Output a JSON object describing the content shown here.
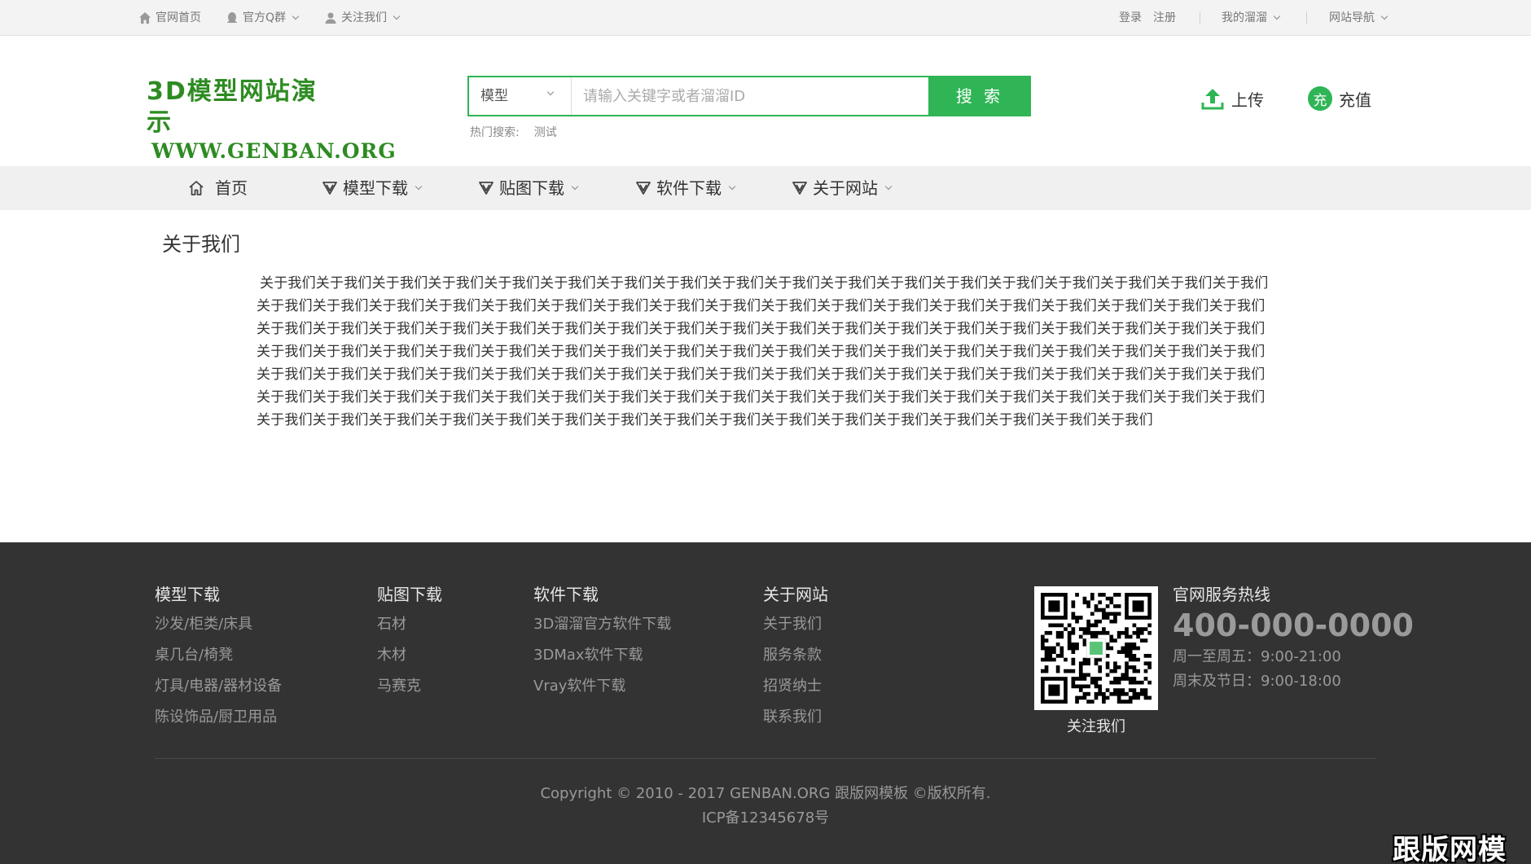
{
  "topbar": {
    "home": "官网首页",
    "qq_group": "官方Q群",
    "follow": "关注我们",
    "login": "登录",
    "register": "注册",
    "my_liuliu": "我的溜溜",
    "site_nav": "网站导航"
  },
  "header": {
    "logo_line1": "3D模型网站演示",
    "logo_line2": "WWW.GENBAN.ORG",
    "search_category": "模型",
    "search_placeholder": "请输入关键字或者溜溜ID",
    "search_button": "搜 索",
    "hot_label": "热门搜索:",
    "hot_term": "测试",
    "upload": "上传",
    "recharge": "充值",
    "recharge_badge": "充"
  },
  "nav": {
    "home": "首页",
    "models": "模型下载",
    "textures": "贴图下载",
    "software": "软件下载",
    "about": "关于网站"
  },
  "content": {
    "title": "关于我们",
    "body": "关于我们关于我们关于我们关于我们关于我们关于我们关于我们关于我们关于我们关于我们关于我们关于我们关于我们关于我们关于我们关于我们关于我们关于我们关于我们关于我们关于我们关于我们关于我们关于我们关于我们关于我们关于我们关于我们关于我们关于我们关于我们关于我们关于我们关于我们关于我们关于我们关于我们关于我们关于我们关于我们关于我们关于我们关于我们关于我们关于我们关于我们关于我们关于我们关于我们关于我们关于我们关于我们关于我们关于我们关于我们关于我们关于我们关于我们关于我们关于我们关于我们关于我们关于我们关于我们关于我们关于我们关于我们关于我们关于我们关于我们关于我们关于我们关于我们关于我们关于我们关于我们关于我们关于我们关于我们关于我们关于我们关于我们关于我们关于我们关于我们关于我们关于我们关于我们关于我们关于我们关于我们关于我们关于我们关于我们关于我们关于我们关于我们关于我们关于我们关于我们关于我们关于我们关于我们关于我们关于我们关于我们关于我们关于我们关于我们关于我们关于我们关于我们关于我们关于我们关于我们关于我们关于我们关于我们关于我们关于我们关于我们关于我们关于我们关于我们"
  },
  "footer": {
    "col1": {
      "title": "模型下载",
      "links": [
        "沙发/柜类/床具",
        "桌几台/椅凳",
        "灯具/电器/器材设备",
        "陈设饰品/厨卫用品"
      ]
    },
    "col2": {
      "title": "贴图下载",
      "links": [
        "石材",
        "木材",
        "马赛克"
      ]
    },
    "col3": {
      "title": "软件下载",
      "links": [
        "3D溜溜官方软件下载",
        "3DMax软件下载",
        "Vray软件下载"
      ]
    },
    "col4": {
      "title": "关于网站",
      "links": [
        "关于我们",
        "服务条款",
        "招贤纳士",
        "联系我们"
      ]
    },
    "qr_label": "关注我们",
    "hotline_title": "官网服务热线",
    "hotline_number": "400-000-0000",
    "hours_weekday": "周一至周五：9:00-21:00",
    "hours_weekend": "周末及节日：9:00-18:00",
    "copyright": "Copyright © 2010 - 2017 GENBAN.ORG 跟版网模板 ©版权所有.",
    "icp": "ICP备12345678号"
  },
  "watermark": "跟版网模板",
  "colors": {
    "accent": "#2fb555",
    "logo": "#2e8b22",
    "footer_bg": "#333333"
  }
}
